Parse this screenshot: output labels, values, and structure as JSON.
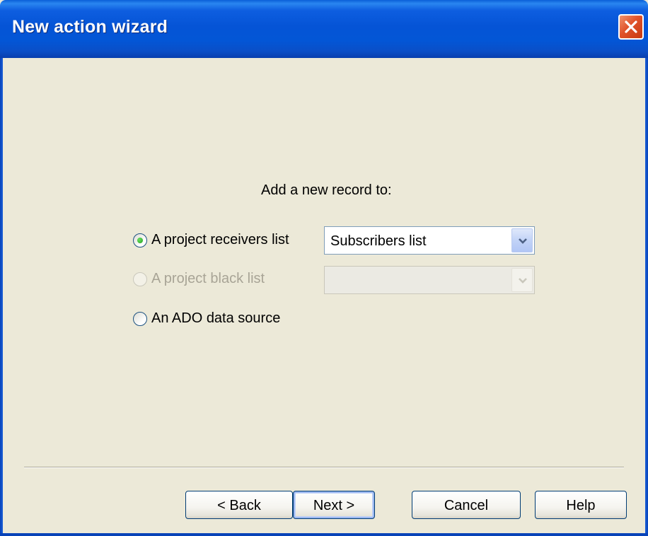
{
  "window": {
    "title": "New action wizard"
  },
  "content": {
    "prompt": "Add a new record to:",
    "options": [
      {
        "label": "A project receivers list",
        "checked": true,
        "enabled": true
      },
      {
        "label": "A project black list",
        "checked": false,
        "enabled": false
      },
      {
        "label": "An ADO data source",
        "checked": false,
        "enabled": true
      }
    ],
    "receivers_combo": {
      "value": "Subscribers list"
    },
    "blacklist_combo": {
      "value": ""
    }
  },
  "buttons": {
    "back": "< Back",
    "next": "Next >",
    "cancel": "Cancel",
    "help": "Help"
  },
  "icons": {
    "close": "close-icon",
    "dropdown": "chevron-down-icon"
  },
  "colors": {
    "titlebar": "#0356d6",
    "dialog_bg": "#ece9d8",
    "close_button": "#e0522a",
    "radio_checked": "#21a121"
  }
}
